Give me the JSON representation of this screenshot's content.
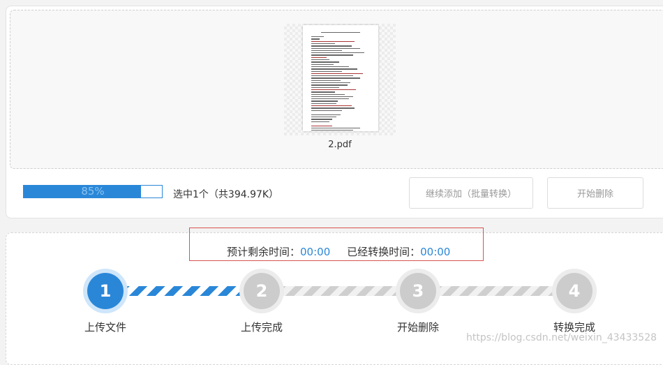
{
  "file": {
    "name": "2.pdf"
  },
  "progress": {
    "value": 85,
    "label": "85%"
  },
  "selection": {
    "info": "选中1个（共394.97K）"
  },
  "buttons": {
    "add_more": "继续添加（批量转换）",
    "start_delete": "开始删除"
  },
  "timing": {
    "remaining_label": "预计剩余时间：",
    "remaining_value": "00:00",
    "elapsed_label": "已经转换时间：",
    "elapsed_value": "00:00"
  },
  "steps": [
    {
      "number": "1",
      "label": "上传文件",
      "active": true
    },
    {
      "number": "2",
      "label": "上传完成",
      "active": false
    },
    {
      "number": "3",
      "label": "开始删除",
      "active": false
    },
    {
      "number": "4",
      "label": "转换完成",
      "active": false
    }
  ],
  "watermark": "https://blog.csdn.net/weixin_43433528",
  "colors": {
    "accent": "#2a87d8",
    "inactive": "#cccccc",
    "highlight_box": "#d9534f"
  }
}
